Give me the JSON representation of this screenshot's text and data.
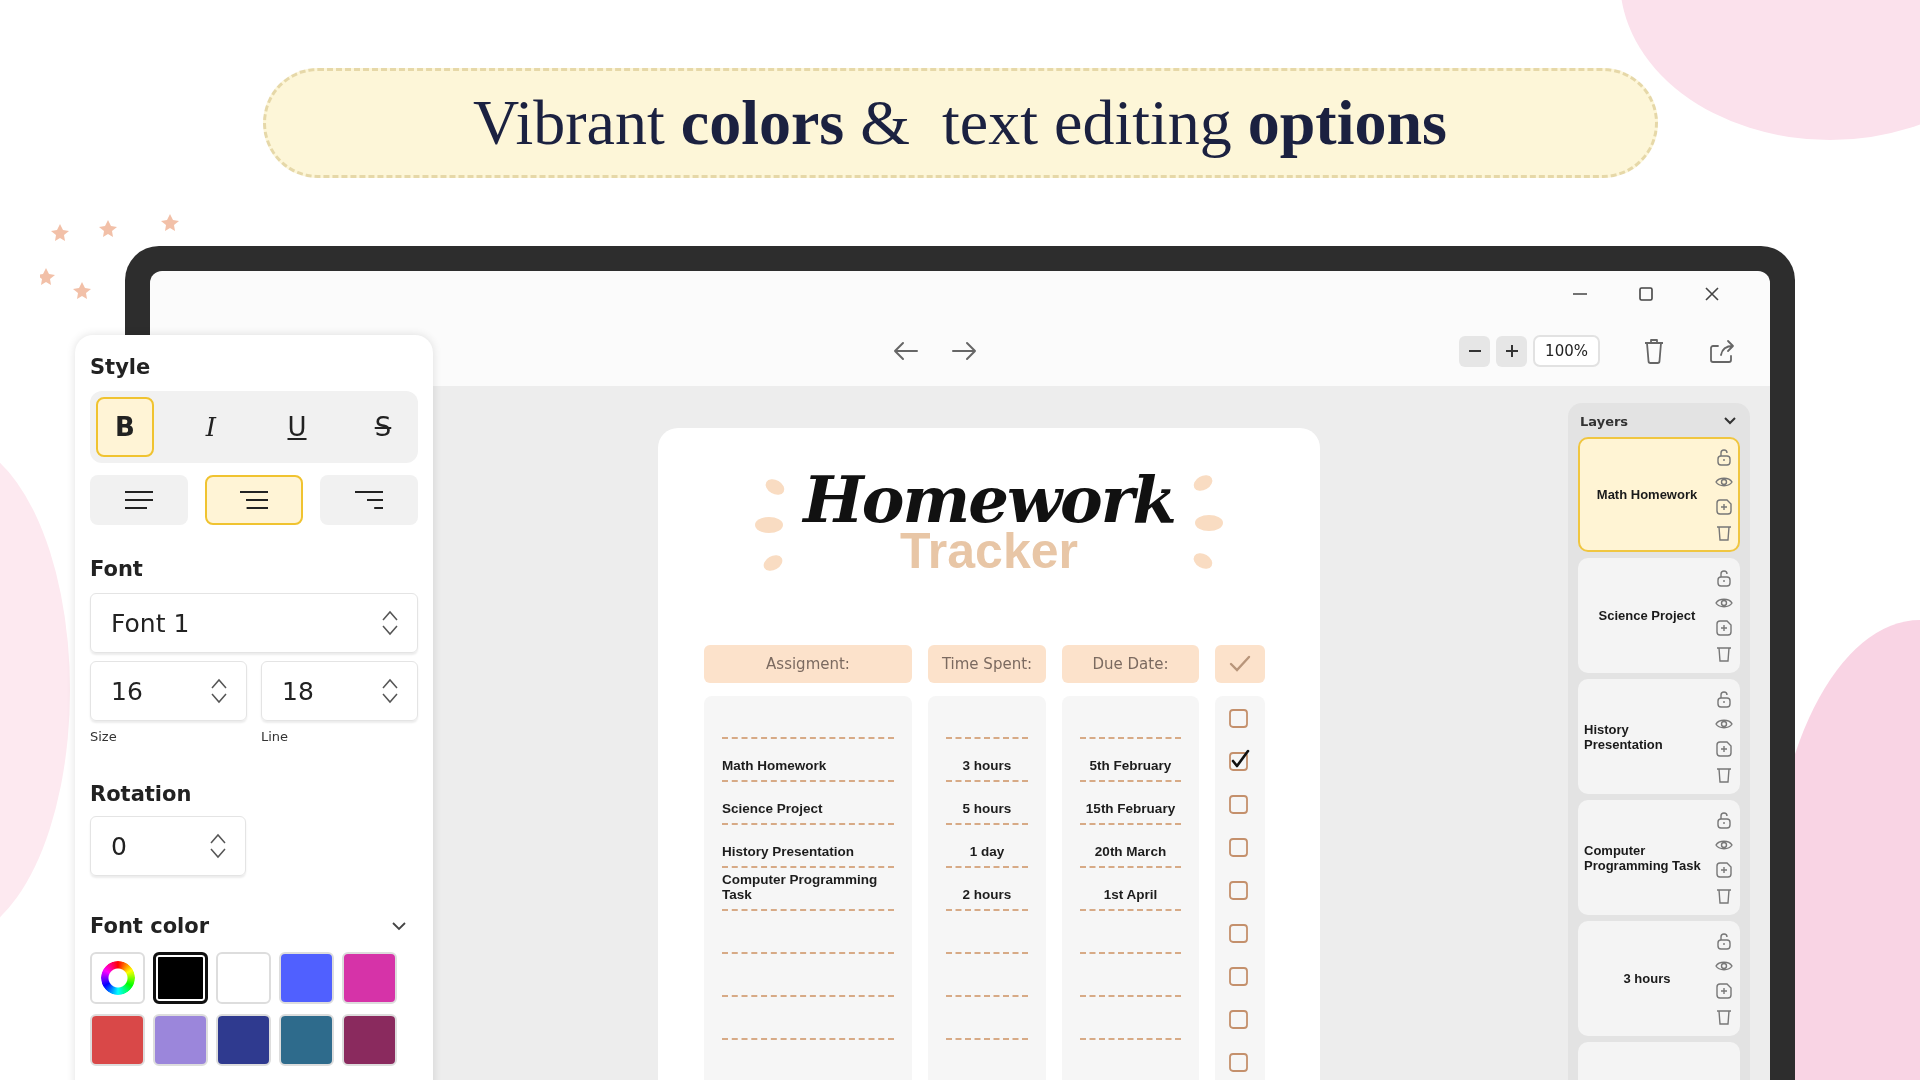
{
  "heading": "Vibrant **colors** &  text editing **options**",
  "toolbar": {
    "zoom": "100%"
  },
  "style_panel": {
    "style_title": "Style",
    "style_buttons": [
      {
        "kind": "bold",
        "label": "B",
        "selected": true
      },
      {
        "kind": "italic",
        "label": "I",
        "selected": false
      },
      {
        "kind": "underline",
        "label": "U",
        "selected": false
      },
      {
        "kind": "strike",
        "label": "S",
        "selected": false
      }
    ],
    "align_buttons": [
      {
        "kind": "left",
        "selected": false
      },
      {
        "kind": "center",
        "selected": true
      },
      {
        "kind": "right",
        "selected": false
      }
    ],
    "font_title": "Font",
    "font": "Font 1",
    "size": {
      "value": "16",
      "label": "Size"
    },
    "line": {
      "value": "18",
      "label": "Line"
    },
    "rotation_title": "Rotation",
    "rotation": "0",
    "font_color_title": "Font color",
    "swatches": [
      {
        "kind": "picker",
        "selected": false
      },
      {
        "kind": "color",
        "color": "#000000",
        "selected": true
      },
      {
        "kind": "color",
        "color": "#ffffff",
        "selected": false
      },
      {
        "kind": "color",
        "color": "#5060ff",
        "selected": false
      },
      {
        "kind": "color",
        "color": "#d633a8",
        "selected": false
      },
      {
        "kind": "color",
        "color": "#d94848",
        "selected": false
      },
      {
        "kind": "color",
        "color": "#9b86db",
        "selected": false
      },
      {
        "kind": "color",
        "color": "#2f3a8f",
        "selected": false
      },
      {
        "kind": "color",
        "color": "#2e6b8c",
        "selected": false
      },
      {
        "kind": "color",
        "color": "#8a2a5e",
        "selected": false
      }
    ]
  },
  "tracker": {
    "title": "Homework",
    "subtitle": "Tracker",
    "columns": [
      "Assigment:",
      "Time Spent:",
      "Due Date:"
    ],
    "rows": [
      {
        "done": false
      },
      {
        "assignment": "Math Homework",
        "time_spent": "3 hours",
        "due_date": "5th February",
        "done": true
      },
      {
        "assignment": "Science Project",
        "time_spent": "5 hours",
        "due_date": "15th February",
        "done": false
      },
      {
        "assignment": "History Presentation",
        "time_spent": "1 day",
        "due_date": "20th March",
        "done": false
      },
      {
        "assignment": "Computer Programming Task",
        "time_spent": "2 hours",
        "due_date": "1st April",
        "done": false
      },
      {
        "done": false
      },
      {
        "done": false
      },
      {
        "done": false
      },
      {
        "done": false
      }
    ]
  },
  "layers": {
    "title": "Layers",
    "items": [
      {
        "label": "Math Homework",
        "selected": true
      },
      {
        "label": "Science Project",
        "selected": false
      },
      {
        "label": "History Presentation",
        "selected": false
      },
      {
        "label": "Computer Programming Task",
        "selected": false
      },
      {
        "label": "3 hours",
        "selected": false
      },
      {
        "selected": false
      }
    ]
  }
}
